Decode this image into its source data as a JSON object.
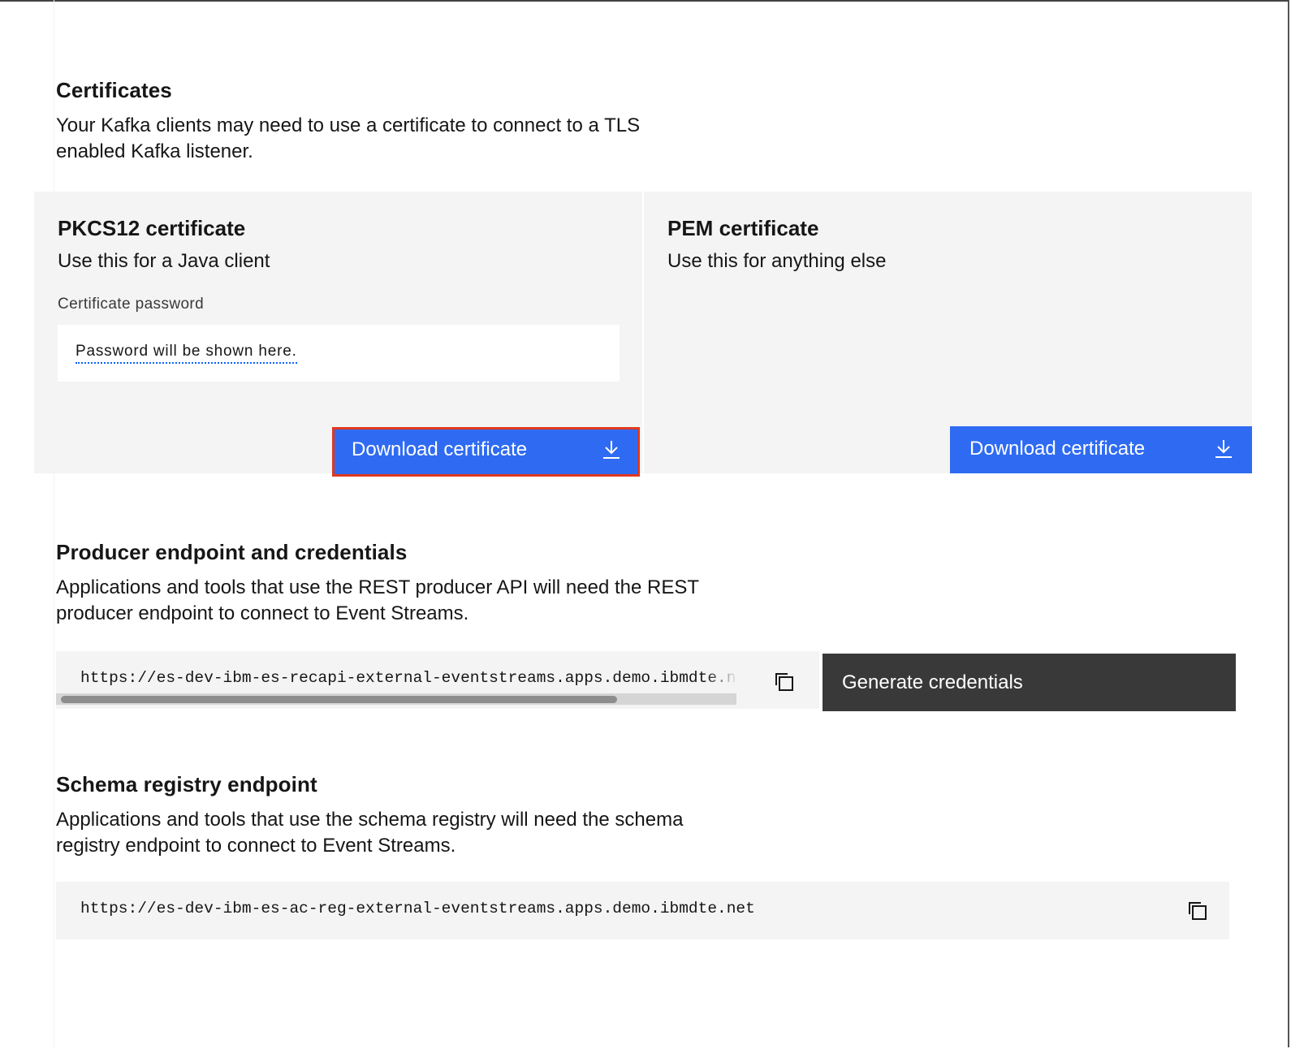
{
  "certificates": {
    "title": "Certificates",
    "description_line1": "Your Kafka clients may need to use a certificate to connect to a TLS",
    "description_line2": "enabled Kafka listener."
  },
  "pkcs12": {
    "title": "PKCS12 certificate",
    "subtitle": "Use this for a Java client",
    "field_label": "Certificate password",
    "password_placeholder": "Password will be shown here.",
    "download_label": "Download certificate"
  },
  "pem": {
    "title": "PEM certificate",
    "subtitle": "Use this for anything else",
    "download_label": "Download certificate"
  },
  "producer": {
    "title": "Producer endpoint and credentials",
    "description_line1": "Applications and tools that use the REST producer API will need the REST",
    "description_line2": "producer endpoint to connect to Event Streams.",
    "endpoint": "https://es-dev-ibm-es-recapi-external-eventstreams.apps.demo.ibmdte.net",
    "generate_label": "Generate credentials"
  },
  "schema": {
    "title": "Schema registry endpoint",
    "description_line1": "Applications and tools that use the schema registry will need the schema",
    "description_line2": "registry endpoint to connect to Event Streams.",
    "endpoint": "https://es-dev-ibm-es-ac-reg-external-eventstreams.apps.demo.ibmdte.net"
  },
  "icons": {
    "download": "download-icon",
    "copy": "copy-icon"
  },
  "colors": {
    "primary_button": "#2f6bf2",
    "secondary_button": "#393939",
    "tile_background": "#f4f4f4",
    "highlight_outline": "#e0381f"
  }
}
